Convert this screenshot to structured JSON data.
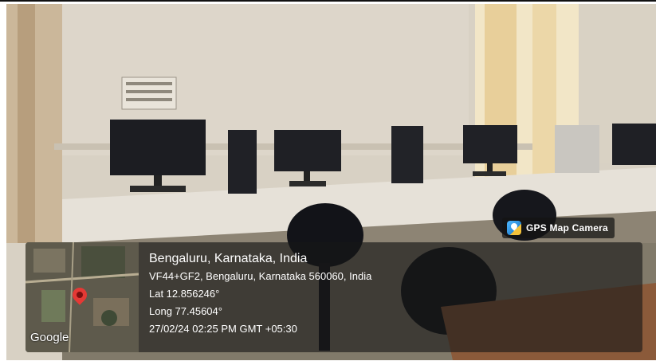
{
  "badge": {
    "label": "GPS Map Camera",
    "icon": "gps-map-camera-icon"
  },
  "map": {
    "brand": "Google",
    "pin_icon": "location-pin-icon"
  },
  "location": {
    "place": "Bengaluru, Karnataka, India",
    "address": "VF44+GF2, Bengaluru, Karnataka 560060, India",
    "lat": "Lat 12.856246°",
    "long": "Long 77.45604°",
    "datetime": "27/02/24 02:25 PM GMT +05:30"
  }
}
